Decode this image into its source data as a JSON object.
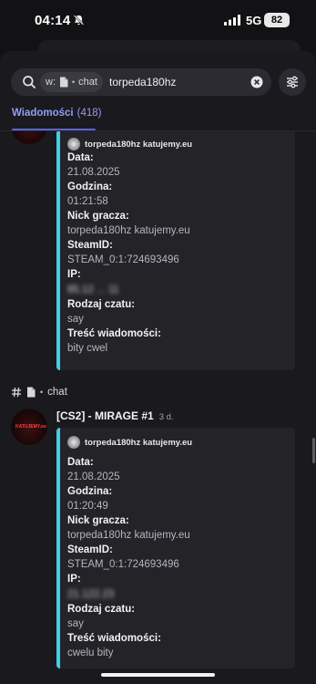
{
  "status_bar": {
    "time": "04:14",
    "network": "5G",
    "battery": "82"
  },
  "search": {
    "filter_prefix": "w:",
    "filter_channel": "chat",
    "query": "torpeda180hz"
  },
  "tabs": {
    "messages_label": "Wiadomości",
    "messages_count": "(418)"
  },
  "colors": {
    "accent": "#5865f2",
    "embed_bar": "#3fd0e6",
    "background": "#1a1a1e"
  },
  "results": [
    {
      "embed": {
        "author": "torpeda180hz katujemy.eu",
        "fields": [
          {
            "name": "Data:",
            "value": "21.08.2025"
          },
          {
            "name": "Godzina:",
            "value": "01:21:58"
          },
          {
            "name": "Nick gracza:",
            "value": "torpeda180hz katujemy.eu"
          },
          {
            "name": "SteamID:",
            "value": "STEAM_0:1:724693496"
          },
          {
            "name": "IP:",
            "value": "85.12 ... 11"
          },
          {
            "name": "Rodzaj czatu:",
            "value": "say"
          },
          {
            "name": "Treść wiadomości:",
            "value": "bity cwel"
          }
        ]
      }
    },
    {
      "channel": "chat",
      "author_avatar_text": "KATUJEMY.eu",
      "author": "[CS2] - MIRAGE #1",
      "time": "3 d.",
      "embed": {
        "author": "torpeda180hz katujemy.eu",
        "fields": [
          {
            "name": "Data:",
            "value": "21.08.2025"
          },
          {
            "name": "Godzina:",
            "value": "01:20:49"
          },
          {
            "name": "Nick gracza:",
            "value": "torpeda180hz katujemy.eu"
          },
          {
            "name": "SteamID:",
            "value": "STEAM_0:1:724693496"
          },
          {
            "name": "IP:",
            "value": "21.122.23"
          },
          {
            "name": "Rodzaj czatu:",
            "value": "say"
          },
          {
            "name": "Treść wiadomości:",
            "value": "cwelu bity"
          }
        ]
      }
    }
  ]
}
